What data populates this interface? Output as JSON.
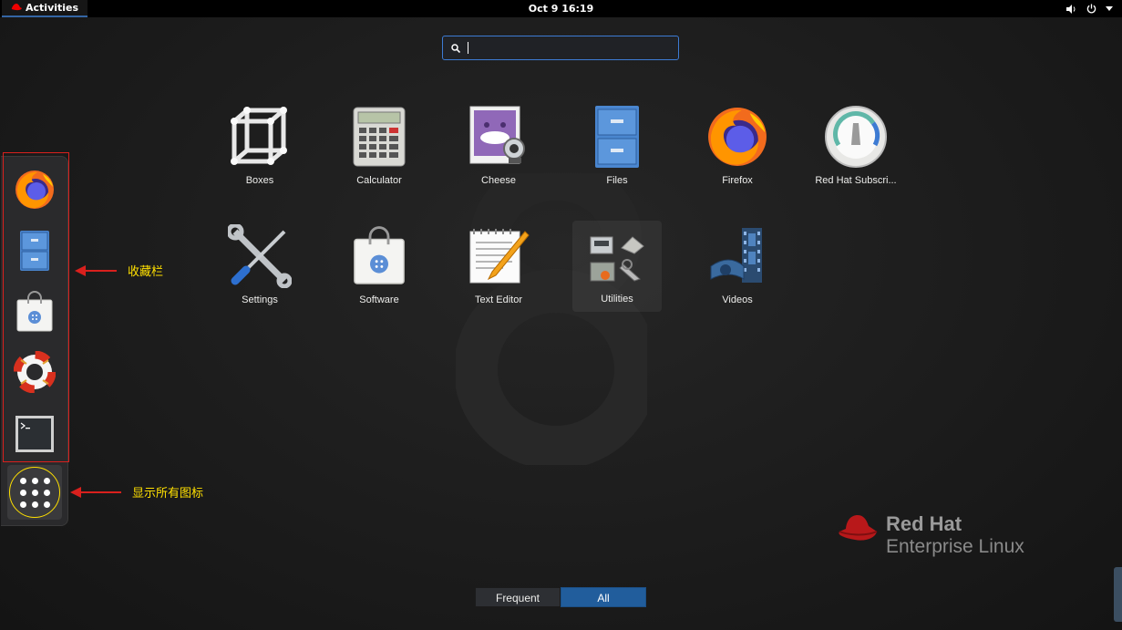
{
  "topbar": {
    "activities_label": "Activities",
    "clock": "Oct 9  16:19",
    "icons": [
      "volume-icon",
      "power-icon",
      "chevron-down-icon"
    ]
  },
  "search": {
    "value": "",
    "placeholder": ""
  },
  "dock": {
    "items": [
      {
        "name": "Firefox",
        "icon": "firefox-icon"
      },
      {
        "name": "Files",
        "icon": "files-icon"
      },
      {
        "name": "Software",
        "icon": "software-icon"
      },
      {
        "name": "Help",
        "icon": "help-icon"
      },
      {
        "name": "Terminal",
        "icon": "terminal-icon"
      }
    ],
    "show_apps_icon": "grid-icon"
  },
  "annotations": {
    "favorites": "收藏栏",
    "show_apps": "显示所有图标",
    "color": "#ffe000",
    "arrow_color": "#d9201d"
  },
  "apps": [
    {
      "label": "Boxes",
      "icon": "boxes-icon"
    },
    {
      "label": "Calculator",
      "icon": "calculator-icon"
    },
    {
      "label": "Cheese",
      "icon": "cheese-icon"
    },
    {
      "label": "Files",
      "icon": "files-icon"
    },
    {
      "label": "Firefox",
      "icon": "firefox-icon"
    },
    {
      "label": "Red Hat Subscri...",
      "icon": "subscription-icon"
    },
    {
      "label": "Settings",
      "icon": "settings-icon"
    },
    {
      "label": "Software",
      "icon": "software-icon"
    },
    {
      "label": "Text Editor",
      "icon": "text-editor-icon"
    },
    {
      "label": "Utilities",
      "icon": "utilities-folder-icon"
    },
    {
      "label": "Videos",
      "icon": "videos-icon"
    }
  ],
  "view_switch": {
    "frequent": "Frequent",
    "all": "All",
    "selected": "All"
  },
  "branding": {
    "line1": "Red Hat",
    "line2": "Enterprise Linux"
  },
  "colors": {
    "accent": "#3d7bd3",
    "selected_tab": "#215d9c",
    "highlight_red": "#d9201d"
  }
}
